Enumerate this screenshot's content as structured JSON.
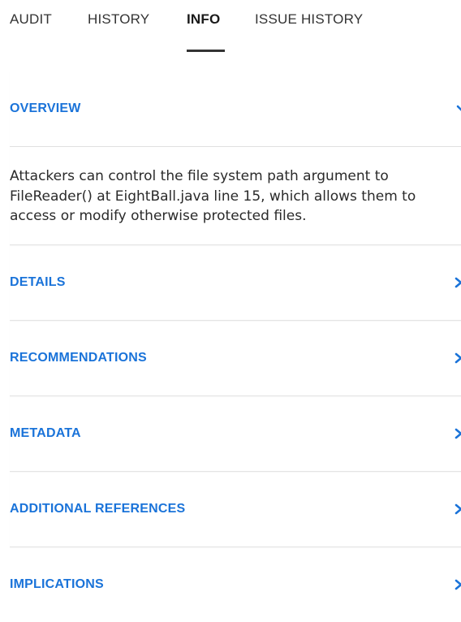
{
  "tabs": [
    {
      "label": "AUDIT"
    },
    {
      "label": "HISTORY"
    },
    {
      "label": "INFO",
      "active": true
    },
    {
      "label": "ISSUE HISTORY"
    }
  ],
  "sections": {
    "overview": {
      "title": "OVERVIEW",
      "expanded": true,
      "body": "Attackers can control the file system path argument to FileReader() at EightBall.java line 15, which allows them to access or modify otherwise protected files."
    },
    "details": {
      "title": "DETAILS"
    },
    "recommendations": {
      "title": "RECOMMENDATIONS"
    },
    "metadata": {
      "title": "METADATA"
    },
    "additional_references": {
      "title": "ADDITIONAL REFERENCES"
    },
    "implications": {
      "title": "IMPLICATIONS"
    }
  },
  "colors": {
    "accent": "#1a73d9",
    "text": "#2a2a2a",
    "divider": "#e4e4e4"
  },
  "icons": {
    "collapse": "chevron-down-icon",
    "expand": "chevron-right-icon"
  }
}
